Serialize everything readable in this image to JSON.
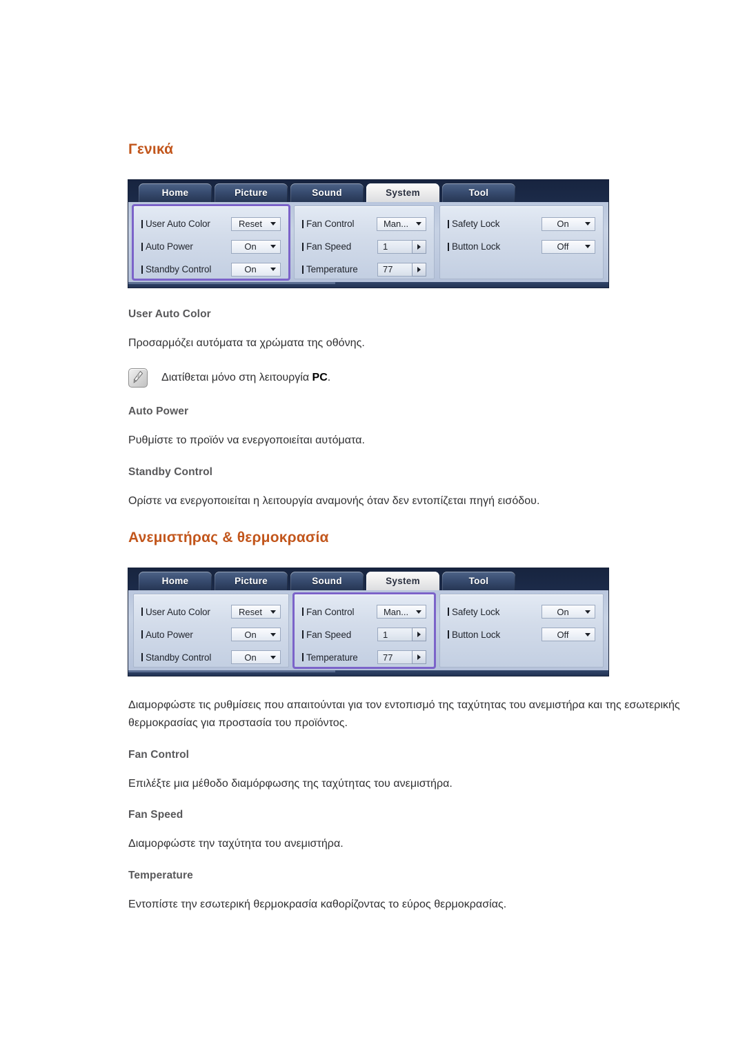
{
  "page": {
    "heading_color": "#C2561C",
    "subheading_color": "#58585A"
  },
  "sections": [
    {
      "title": "Γενικά",
      "osd": {
        "tabs": [
          {
            "label": "Home",
            "active": false
          },
          {
            "label": "Picture",
            "active": false
          },
          {
            "label": "Sound",
            "active": false
          },
          {
            "label": "System",
            "active": true
          },
          {
            "label": "Tool",
            "active": false
          }
        ],
        "highlight_group": 1,
        "highlight_color": "#7B63C9",
        "groups": [
          {
            "rows": [
              {
                "label": "User Auto Color",
                "value": "Reset",
                "control": "select"
              },
              {
                "label": "Auto Power",
                "value": "On",
                "control": "select"
              },
              {
                "label": "Standby Control",
                "value": "On",
                "control": "select"
              }
            ]
          },
          {
            "rows": [
              {
                "label": "Fan Control",
                "value": "Man...",
                "control": "select"
              },
              {
                "label": "Fan Speed",
                "value": "1",
                "control": "spin"
              },
              {
                "label": "Temperature",
                "value": "77",
                "control": "spin"
              }
            ]
          },
          {
            "rows": [
              {
                "label": "Safety Lock",
                "value": "On",
                "control": "select"
              },
              {
                "label": "Button Lock",
                "value": "Off",
                "control": "select"
              }
            ]
          }
        ]
      },
      "items": [
        {
          "title": "User Auto Color",
          "body": "Προσαρμόζει αυτόματα τα χρώματα της οθόνης.",
          "note": {
            "icon": "note-pencil-icon",
            "text_before": "Διατίθεται μόνο στη λειτουργία ",
            "text_bold": "PC",
            "text_after": "."
          }
        },
        {
          "title": "Auto Power",
          "body": "Ρυθμίστε το προϊόν να ενεργοποιείται αυτόματα."
        },
        {
          "title": "Standby Control",
          "body": "Ορίστε να ενεργοποιείται η λειτουργία αναμονής όταν δεν εντοπίζεται πηγή εισόδου."
        }
      ]
    },
    {
      "title": "Ανεμιστήρας & θερμοκρασία",
      "osd": {
        "tabs": [
          {
            "label": "Home",
            "active": false
          },
          {
            "label": "Picture",
            "active": false
          },
          {
            "label": "Sound",
            "active": false
          },
          {
            "label": "System",
            "active": true
          },
          {
            "label": "Tool",
            "active": false
          }
        ],
        "highlight_group": 2,
        "highlight_color": "#7B63C9",
        "groups": [
          {
            "rows": [
              {
                "label": "User Auto Color",
                "value": "Reset",
                "control": "select"
              },
              {
                "label": "Auto Power",
                "value": "On",
                "control": "select"
              },
              {
                "label": "Standby Control",
                "value": "On",
                "control": "select"
              }
            ]
          },
          {
            "rows": [
              {
                "label": "Fan Control",
                "value": "Man...",
                "control": "select"
              },
              {
                "label": "Fan Speed",
                "value": "1",
                "control": "spin"
              },
              {
                "label": "Temperature",
                "value": "77",
                "control": "spin"
              }
            ]
          },
          {
            "rows": [
              {
                "label": "Safety Lock",
                "value": "On",
                "control": "select"
              },
              {
                "label": "Button Lock",
                "value": "Off",
                "control": "select"
              }
            ]
          }
        ]
      },
      "intro": "Διαμορφώστε τις ρυθμίσεις που απαιτούνται για τον εντοπισμό της ταχύτητας του ανεμιστήρα και της εσωτερικής θερμοκρασίας για προστασία του προϊόντος.",
      "items": [
        {
          "title": "Fan Control",
          "body": "Επιλέξτε μια μέθοδο διαμόρφωσης της ταχύτητας του ανεμιστήρα."
        },
        {
          "title": "Fan Speed",
          "body": "Διαμορφώστε την ταχύτητα του ανεμιστήρα."
        },
        {
          "title": "Temperature",
          "body": "Εντοπίστε την εσωτερική θερμοκρασία καθορίζοντας το εύρος θερμοκρασίας."
        }
      ]
    }
  ]
}
